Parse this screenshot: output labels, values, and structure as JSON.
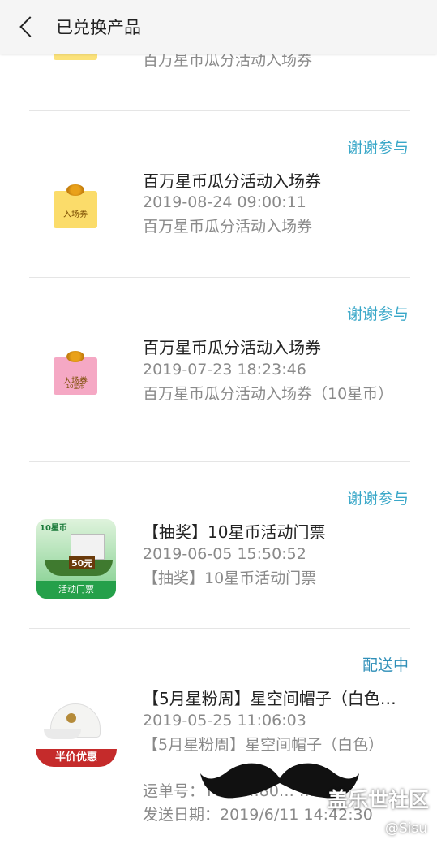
{
  "header": {
    "title": "已兑换产品"
  },
  "items": [
    {
      "status": "",
      "name": "",
      "date": "",
      "desc": "百万星币瓜分活动入场券",
      "thumb": "yellow-ticket"
    },
    {
      "status": "谢谢参与",
      "name": "百万星币瓜分活动入场券",
      "date": "2019-08-24 09:00:11",
      "desc": "百万星币瓜分活动入场券",
      "thumb_label": "入场券",
      "thumb": "yellow-ticket"
    },
    {
      "status": "谢谢参与",
      "name": "百万星币瓜分活动入场券",
      "date": "2019-07-23 18:23:46",
      "desc": "百万星币瓜分活动入场券（10星币）",
      "thumb_label": "入场券",
      "thumb_sub": "10星币",
      "thumb": "pink-ticket"
    },
    {
      "status": "谢谢参与",
      "name": "【抽奖】10星币活动门票",
      "date": "2019-06-05 15:50:52",
      "desc": "【抽奖】10星币活动门票",
      "thumb_top": "10星币",
      "thumb_badge": "50元",
      "thumb_label": "活动门票",
      "thumb": "green-ticket"
    },
    {
      "status": "配送中",
      "name": "【5月星粉周】星空间帽子（白色…",
      "date": "2019-05-25 11:06:03",
      "desc": "【5月星粉周】星空间帽子（白色）",
      "waybill_label": "运单号：",
      "waybill_value": "T0… …80… …22",
      "ship_date": "发送日期：2019/6/11 14:42:30",
      "thumb_label": "半价优惠",
      "thumb": "white-cap"
    }
  ],
  "watermark": {
    "text": "盖乐世社区",
    "user": "@Sisu"
  }
}
